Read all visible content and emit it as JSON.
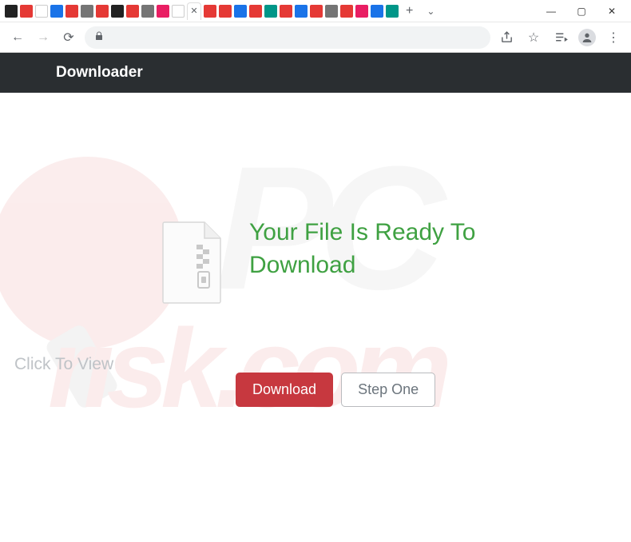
{
  "window": {
    "tabs_count": 27,
    "controls": {
      "minimize": "—",
      "maximize": "▢",
      "close": "✕"
    }
  },
  "toolbar": {
    "back_icon": "←",
    "forward_icon": "→",
    "reload_icon": "⟳",
    "lock_icon": "🔒",
    "share_icon": "⇪",
    "star_icon": "☆",
    "playlist_icon": "≡♪",
    "menu_icon": "⋮"
  },
  "page": {
    "header_title": "Downloader",
    "headline": "Your File Is Ready To Download",
    "buttons": {
      "download": "Download",
      "step_one": "Step One"
    },
    "watermark_overlay": "Click To View",
    "watermark_brand_top": "PC",
    "watermark_brand_bottom": "risk.com",
    "colors": {
      "accent_green": "#3fa142",
      "danger_red": "#c7383f",
      "header_dark": "#2a2e31"
    }
  }
}
